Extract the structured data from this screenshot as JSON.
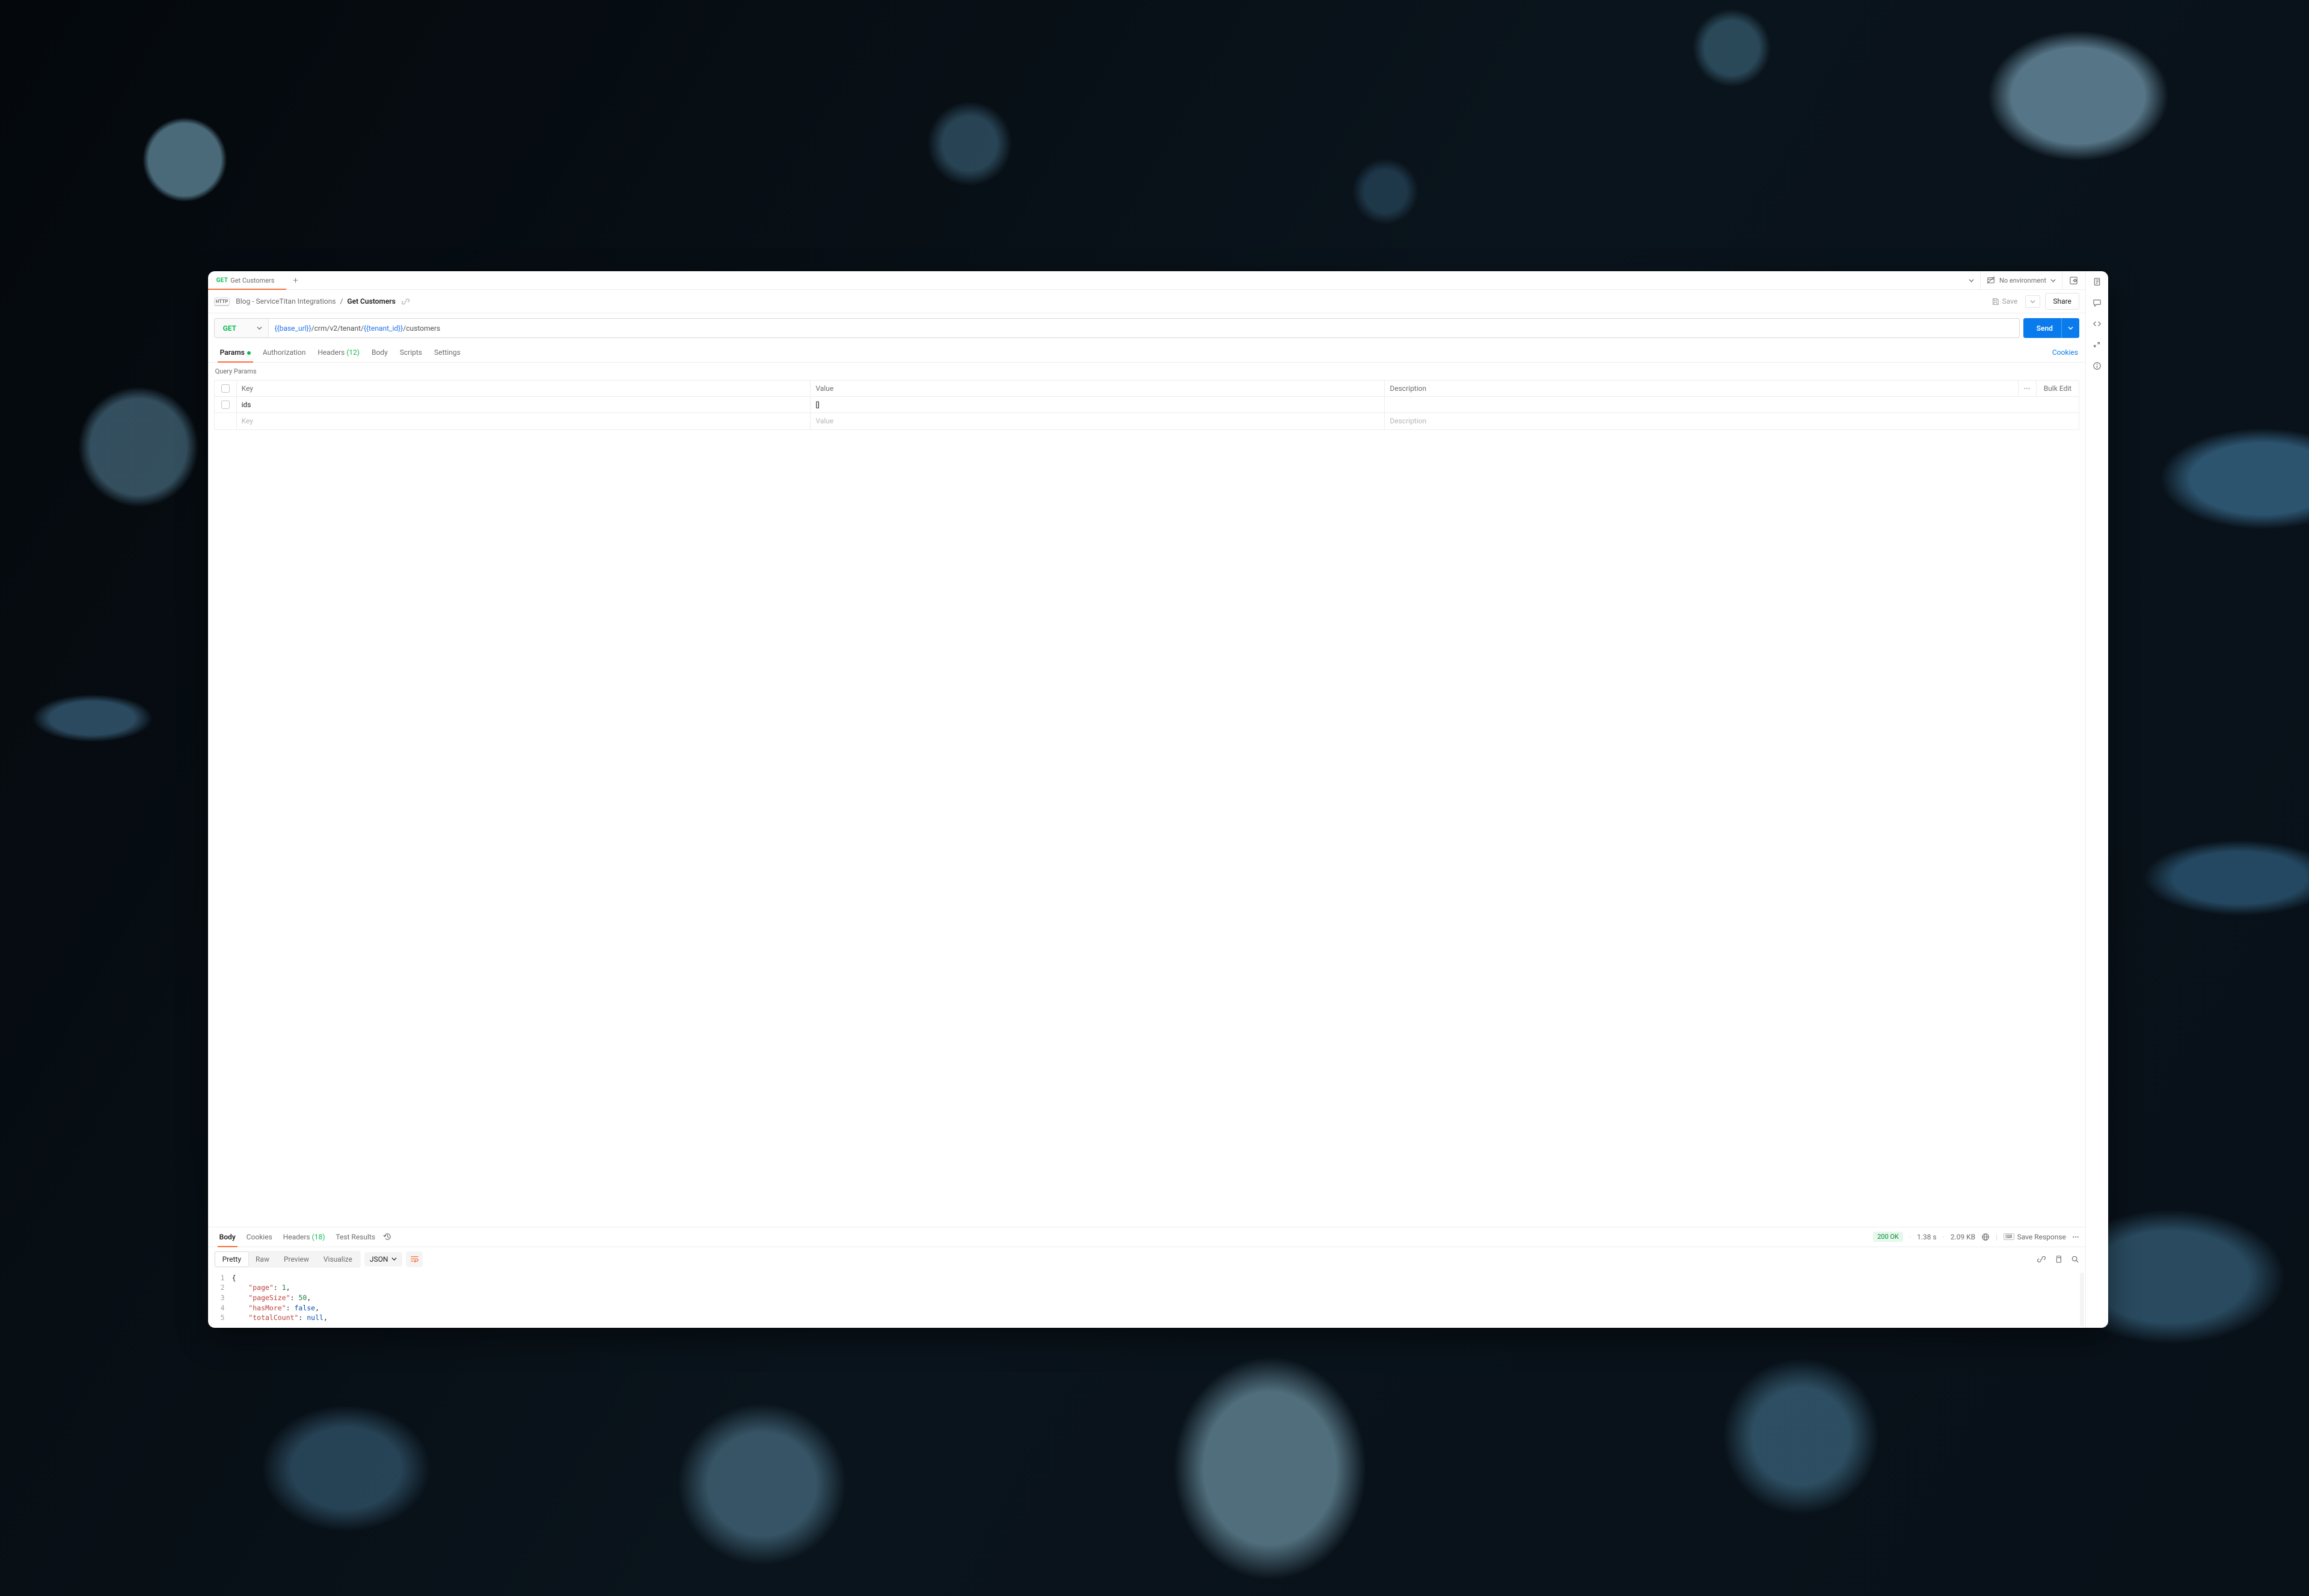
{
  "tabs": {
    "active": {
      "method": "GET",
      "title": "Get Customers"
    }
  },
  "environment": {
    "label": "No environment"
  },
  "breadcrumb": {
    "workspace": "Blog - ServiceTitan Integrations",
    "current": "Get Customers"
  },
  "actions": {
    "save": "Save",
    "share": "Share"
  },
  "request": {
    "method": "GET",
    "url": {
      "part1_var": "{{base_url}}",
      "part2_txt": " /crm/v2/tenant/ ",
      "part3_var": "{{tenant_id}}",
      "part4_txt": " /customers"
    },
    "send": "Send"
  },
  "reqTabs": {
    "params": "Params",
    "authorization": "Authorization",
    "headers": "Headers",
    "headers_count": "(12)",
    "body": "Body",
    "scripts": "Scripts",
    "settings": "Settings",
    "cookies": "Cookies"
  },
  "queryParams": {
    "title": "Query Params",
    "headers": {
      "key": "Key",
      "value": "Value",
      "description": "Description",
      "bulk": "Bulk Edit"
    },
    "rows": [
      {
        "key": "ids",
        "value": "[]",
        "description": ""
      }
    ],
    "placeholders": {
      "key": "Key",
      "value": "Value",
      "description": "Description"
    }
  },
  "response": {
    "tabs": {
      "body": "Body",
      "cookies": "Cookies",
      "headers": "Headers",
      "headers_count": "(18)",
      "test": "Test Results"
    },
    "status": "200 OK",
    "time": "1.38 s",
    "size": "2.09 KB",
    "saveResponse": "Save Response",
    "view": {
      "pretty": "Pretty",
      "raw": "Raw",
      "preview": "Preview",
      "visualize": "Visualize",
      "format": "JSON"
    },
    "code": {
      "l1": "{",
      "l2": {
        "indent": "    ",
        "key": "\"page\"",
        "sep": ": ",
        "val": "1",
        "end": ","
      },
      "l3": {
        "indent": "    ",
        "key": "\"pageSize\"",
        "sep": ": ",
        "val": "50",
        "end": ","
      },
      "l4": {
        "indent": "    ",
        "key": "\"hasMore\"",
        "sep": ": ",
        "val": "false",
        "end": ","
      },
      "l5": {
        "indent": "    ",
        "key": "\"totalCount\"",
        "sep": ": ",
        "val": "null",
        "end": ","
      }
    }
  }
}
